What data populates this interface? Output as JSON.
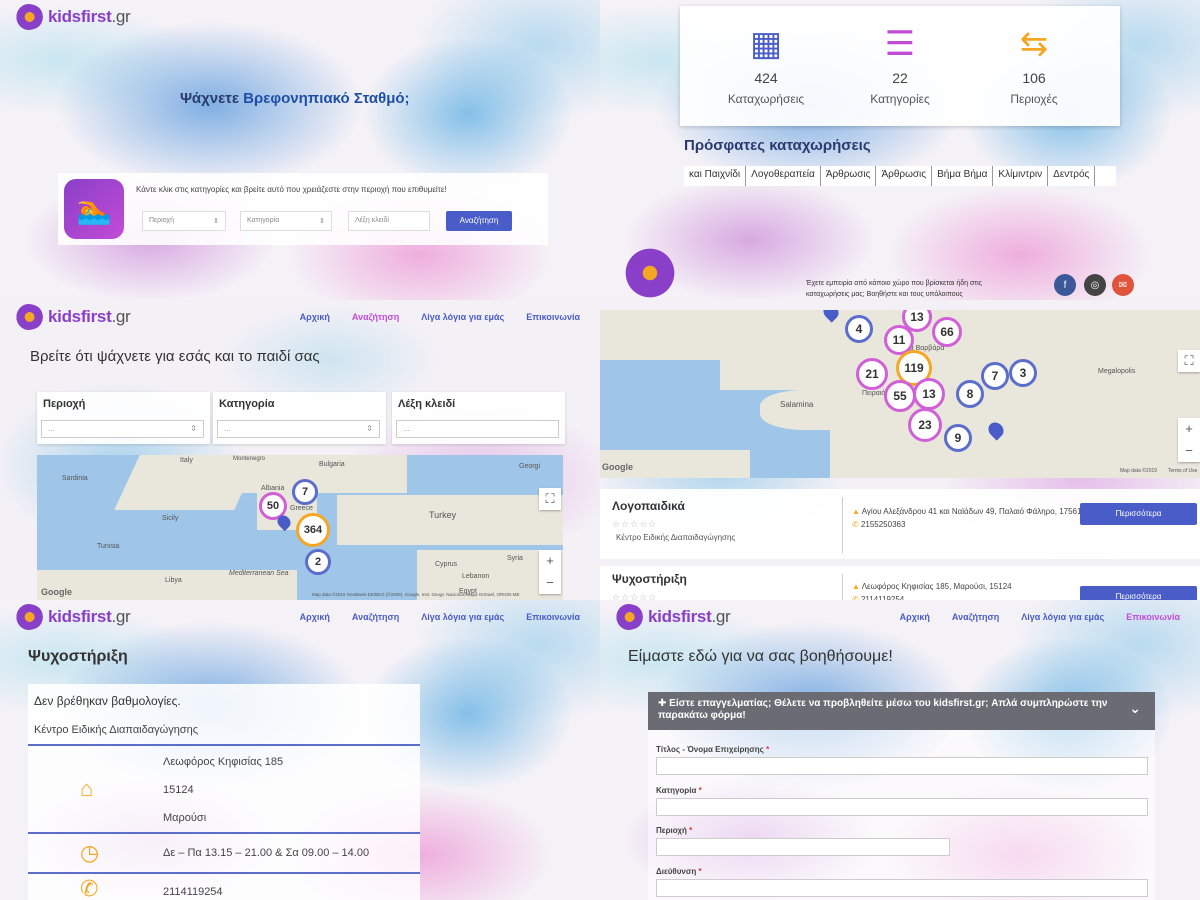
{
  "brand": {
    "name": "kidsfirst",
    "tld": ".gr"
  },
  "nav": {
    "home": "Αρχική",
    "search": "Αναζήτηση",
    "about": "Λίγα λόγια για εμάς",
    "contact": "Επικοινωνία"
  },
  "panel1": {
    "question_prefix": "Ψάχνετε",
    "question_rest": "Βρεφονηπιακό Σταθμό;",
    "hint": "Κάντε κλικ στις κατηγορίες και βρείτε αυτό που χρειάζεστε στην περιοχή που επιθυμείτε!",
    "area_placeholder": "Περιοχή",
    "category_placeholder": "Κατηγορία",
    "keyword_placeholder": "Λέξη κλειδί",
    "search_button": "Αναζήτηση"
  },
  "panel2": {
    "stats": [
      {
        "value": "424",
        "label": "Καταχωρήσεις",
        "icon": "boxes-icon"
      },
      {
        "value": "22",
        "label": "Κατηγορίες",
        "icon": "sliders-icon"
      },
      {
        "value": "106",
        "label": "Περιοχές",
        "icon": "signpost-icon"
      }
    ],
    "recent_title": "Πρόσφατες καταχωρήσεις",
    "tags": [
      "και Παιχνίδι",
      "Λογοθεραπεία",
      "Άρθρωσις",
      "Άρθρωσις",
      "Βήμα Βήμα",
      "Κλίμιντριν",
      "Δεντρός"
    ],
    "experience_text": "Έχετε εμπειρία από κάποιο χώρο που βρίσκεται ήδη στις καταχωρήσεις μας; Βοηθήστε και τους υπόλοιπους",
    "social_colors": {
      "facebook": "#3b5998",
      "instagram": "#444444",
      "email": "#e0533c"
    }
  },
  "panel3": {
    "heading": "Βρείτε ότι ψάχνετε για εσάς και το παιδί σας",
    "filters": [
      {
        "title": "Περιοχή",
        "value": "..."
      },
      {
        "title": "Κατηγορία",
        "value": "..."
      },
      {
        "title": "Λέξη κλειδί",
        "value": "..."
      }
    ],
    "map_labels": [
      "Italy",
      "Bulgaria",
      "Greece",
      "Turkey",
      "Georgi",
      "Albania",
      "Montenegro",
      "Syria",
      "Lebanon",
      "Cyprus",
      "Tunisia",
      "Libya",
      "Egypt",
      "Mediterranean Sea",
      "Sicily",
      "Sardinia"
    ],
    "clusters": [
      {
        "value": "50",
        "style": "pink"
      },
      {
        "value": "7",
        "style": "blue"
      },
      {
        "value": "364",
        "style": "orange"
      },
      {
        "value": "2",
        "style": "blue"
      }
    ],
    "attribution": "Map data ©2019 GeoBasis-DE/BKG (©2009), Google, Inst. Geogr. Nacional, Mapa GISrael, ORION-ME",
    "terms": "Terms of Use"
  },
  "panel4": {
    "clusters": [
      {
        "value": "13",
        "style": "pink"
      },
      {
        "value": "4",
        "style": "blue"
      },
      {
        "value": "66",
        "style": "pink"
      },
      {
        "value": "11",
        "style": "pink"
      },
      {
        "value": "21",
        "style": "pink"
      },
      {
        "value": "119",
        "style": "orange"
      },
      {
        "value": "7",
        "style": "blue"
      },
      {
        "value": "3",
        "style": "blue"
      },
      {
        "value": "55",
        "style": "pink"
      },
      {
        "value": "13",
        "style": "pink"
      },
      {
        "value": "8",
        "style": "blue"
      },
      {
        "value": "23",
        "style": "pink"
      },
      {
        "value": "9",
        "style": "blue"
      }
    ],
    "map_labels": [
      "Salamina",
      "Πειραιάς",
      "Megalopolis",
      "Αγία Βαρβάρα"
    ],
    "attribution": "Map data ©2019",
    "terms": "Terms of Use",
    "listings": [
      {
        "name": "Λογοπαιδικά",
        "stars": "☆☆☆☆☆",
        "category": "Κέντρο Ειδικής Διαπαιδαγώγησης",
        "address": "Αγίου Αλεξάνδρου 41 και Ναϊάδων 49, Παλαιό Φάληρο, 17561",
        "phone": "2155250363",
        "button": "Περισσότερα"
      },
      {
        "name": "Ψυχοστήριξη",
        "stars": "☆☆☆☆☆",
        "category": "",
        "address": "Λεωφόρος Κηφισίας 185, Μαρούσι, 15124",
        "phone": "2114119254",
        "button": "Περισσότερα"
      }
    ]
  },
  "panel5": {
    "heading": "Ψυχοστήριξη",
    "no_ratings": "Δεν βρέθηκαν βαθμολογίες.",
    "category": "Κέντρο Ειδικής Διαπαιδαγώγησης",
    "street": "Λεωφόρος Κηφισίας 185",
    "postcode": "15124",
    "city": "Μαρούσι",
    "hours": "Δε – Πα 13.15 – 21.00 & Σα 09.00 – 14.00",
    "phone": "2114119254"
  },
  "panel6": {
    "heading": "Είμαστε εδώ για να σας βοηθήσουμε!",
    "form_title": "Είστε επαγγελματίας; Θέλετε να προβληθείτε μέσω του kidsfirst.gr; Απλά συμπληρώστε την παρακάτω φόρμα!",
    "fields": [
      {
        "label": "Τίτλος - Όνομα Επιχείρησης"
      },
      {
        "label": "Κατηγορία"
      },
      {
        "label": "Περιοχή"
      },
      {
        "label": "Διεύθυνση"
      }
    ],
    "required_mark": "*"
  },
  "colors": {
    "accent": "#4a5cc8",
    "brand": "#8a3fc8",
    "pink": "#c24bd6",
    "orange": "#f5a623"
  }
}
